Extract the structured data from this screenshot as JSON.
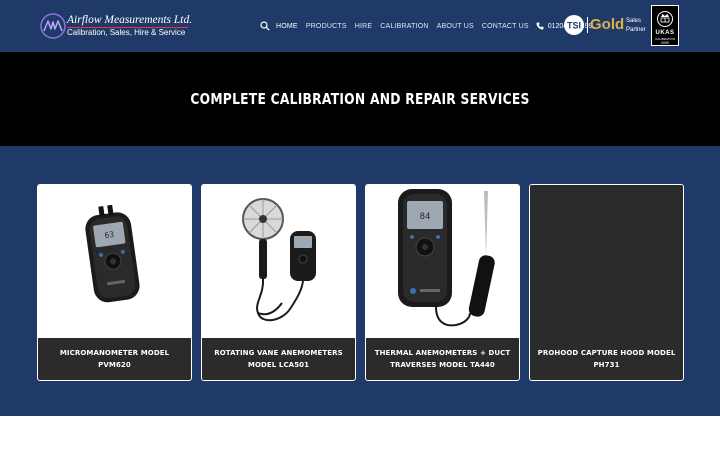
{
  "header": {
    "logo_title": "Airflow Measurements Ltd.",
    "logo_subtitle": "Calibration, Sales, Hire & Service",
    "nav": [
      {
        "label": "HOME",
        "active": true
      },
      {
        "label": "PRODUCTS"
      },
      {
        "label": "HIRE"
      },
      {
        "label": "CALIBRATION"
      },
      {
        "label": "ABOUT US"
      },
      {
        "label": "CONTACT US"
      }
    ],
    "phone": "01204 571499",
    "partner_brand": "TSI",
    "partner_tier": "Gold",
    "partner_line1": "Sales",
    "partner_line2": "Partner",
    "ukas_label": "UKAS",
    "ukas_caption": "CALIBRATION",
    "ukas_number": "0099",
    "icons": [
      "logo-mark-icon",
      "search-icon",
      "phone-icon",
      "tsi-badge-icon",
      "ukas-crown-icon"
    ]
  },
  "hero": {
    "title": "COMPLETE CALIBRATION AND REPAIR SERVICES"
  },
  "products": [
    {
      "caption": "MICROMANOMETER MODEL PVM620",
      "image": "handheld-micromanometer"
    },
    {
      "caption": "ROTATING VANE ANEMOMETERS MODEL LCA501",
      "image": "vane-anemometer"
    },
    {
      "caption": "THERMAL ANEMOMETERS + DUCT TRAVERSES MODEL TA440",
      "image": "thermal-anemometer"
    },
    {
      "caption": "PROHOOD CAPTURE HOOD MODEL PH731",
      "image": ""
    }
  ],
  "colors": {
    "header_bg": "#1f3a68",
    "hero_bg": "#000000",
    "card_caption_bg": "#2b2b2b",
    "gold": "#d8b24a",
    "logo_accent": "#e03a3a"
  }
}
